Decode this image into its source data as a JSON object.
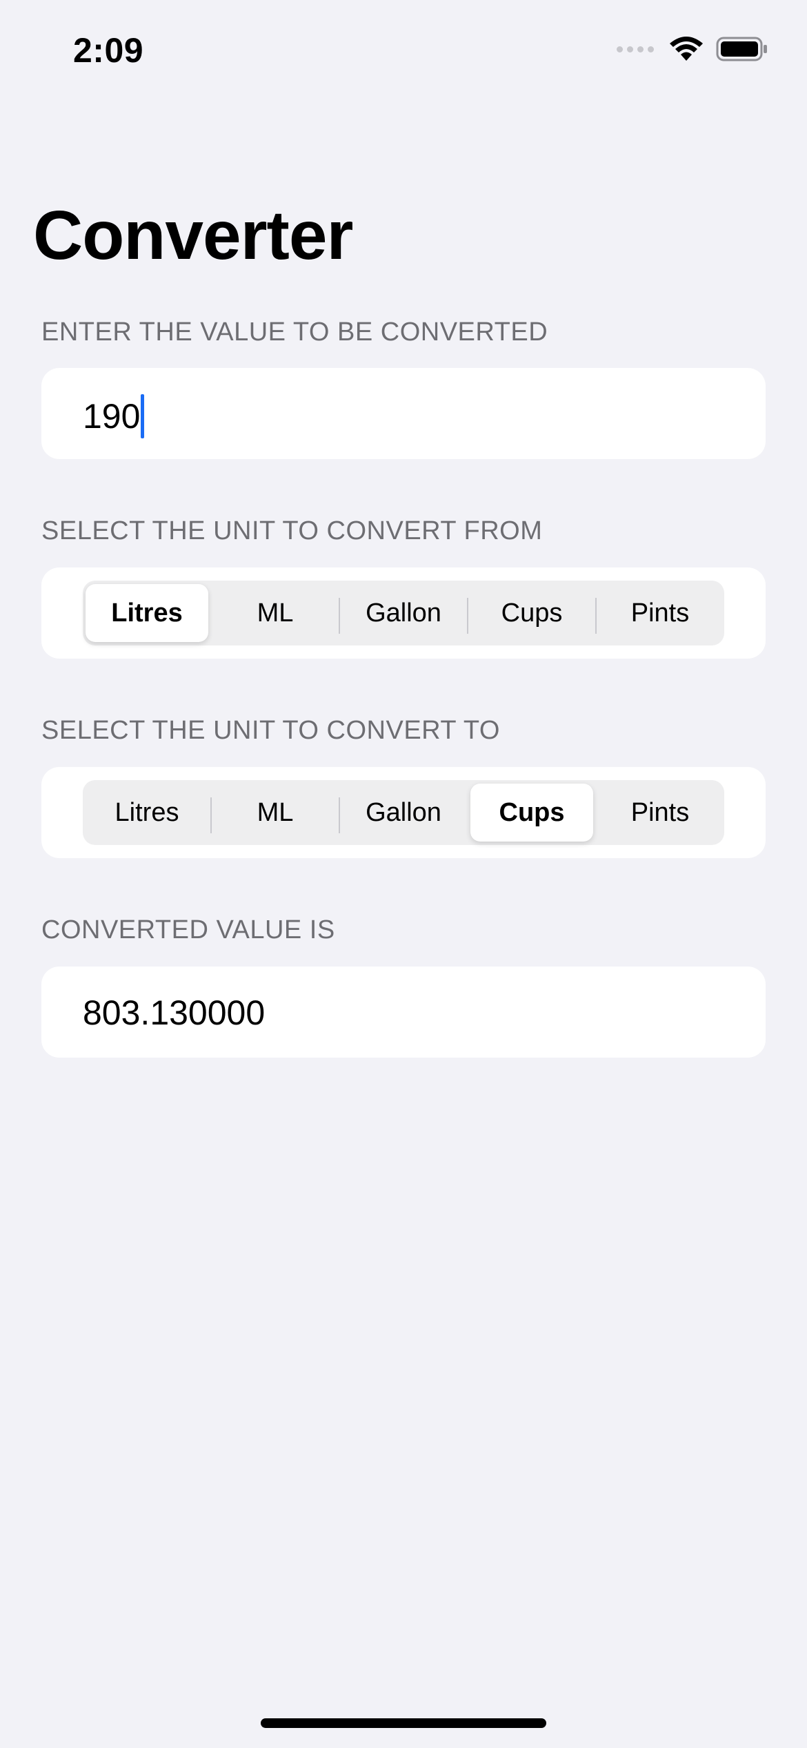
{
  "status_bar": {
    "time": "2:09"
  },
  "title": "Converter",
  "input_section": {
    "header": "ENTER THE VALUE TO BE CONVERTED",
    "value": "190"
  },
  "from_section": {
    "header": "SELECT THE UNIT TO CONVERT FROM",
    "options": [
      "Litres",
      "ML",
      "Gallon",
      "Cups",
      "Pints"
    ],
    "selected": "Litres"
  },
  "to_section": {
    "header": "SELECT THE UNIT TO CONVERT TO",
    "options": [
      "Litres",
      "ML",
      "Gallon",
      "Cups",
      "Pints"
    ],
    "selected": "Cups"
  },
  "result_section": {
    "header": "CONVERTED VALUE IS",
    "value": "803.130000"
  },
  "colors": {
    "background": "#f2f2f7",
    "card": "#ffffff",
    "accent_caret": "#1a6cf5",
    "section_header": "#6d6d72"
  },
  "icons": {
    "signal": "cellular-signal-icon",
    "wifi": "wifi-icon",
    "battery": "battery-icon"
  }
}
